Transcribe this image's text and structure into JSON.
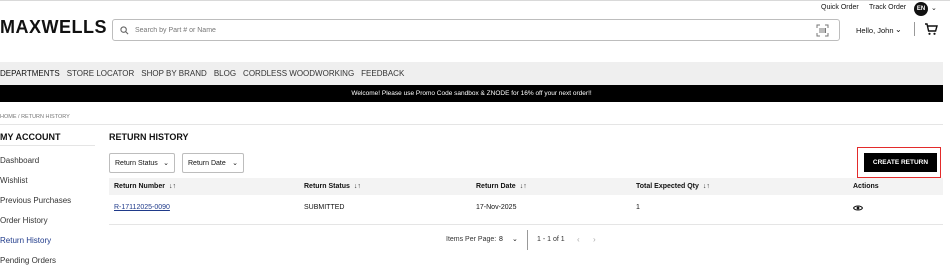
{
  "utility": {
    "quick_order": "Quick Order",
    "track_order": "Track Order",
    "language": "EN"
  },
  "header": {
    "logo": "MAXWELLS",
    "search_placeholder": "Search by Part # or Name",
    "greeting": "Hello, John"
  },
  "nav": {
    "items": [
      "DEPARTMENTS",
      "STORE LOCATOR",
      "SHOP BY BRAND",
      "BLOG",
      "CORDLESS WOODWORKING",
      "FEEDBACK"
    ]
  },
  "promo": "Welcome! Please use Promo Code sandbox & ZNODE for 16% off your next order!!",
  "breadcrumb": "HOME / RETURN HISTORY",
  "sidebar": {
    "title": "MY ACCOUNT",
    "items": [
      "Dashboard",
      "Wishlist",
      "Previous Purchases",
      "Order History",
      "Return History",
      "Pending Orders"
    ],
    "active": "Return History"
  },
  "main": {
    "title": "RETURN HISTORY",
    "filters": {
      "status": "Return Status",
      "date": "Return Date"
    },
    "create_button": "CREATE RETURN",
    "columns": [
      "Return Number",
      "Return Status",
      "Return Date",
      "Total Expected Qty",
      "Actions"
    ],
    "rows": [
      {
        "number": "R-17112025-0090",
        "status": "SUBMITTED",
        "date": "17-Nov-2025",
        "qty": "1"
      }
    ],
    "pagination": {
      "label": "Items Per Page:",
      "per_page": "8",
      "range": "1 - 1 of 1"
    }
  },
  "colors": {
    "accent_link": "#1f3a8a",
    "highlight_border": "#e32b2b",
    "promo_bg": "#000000"
  }
}
